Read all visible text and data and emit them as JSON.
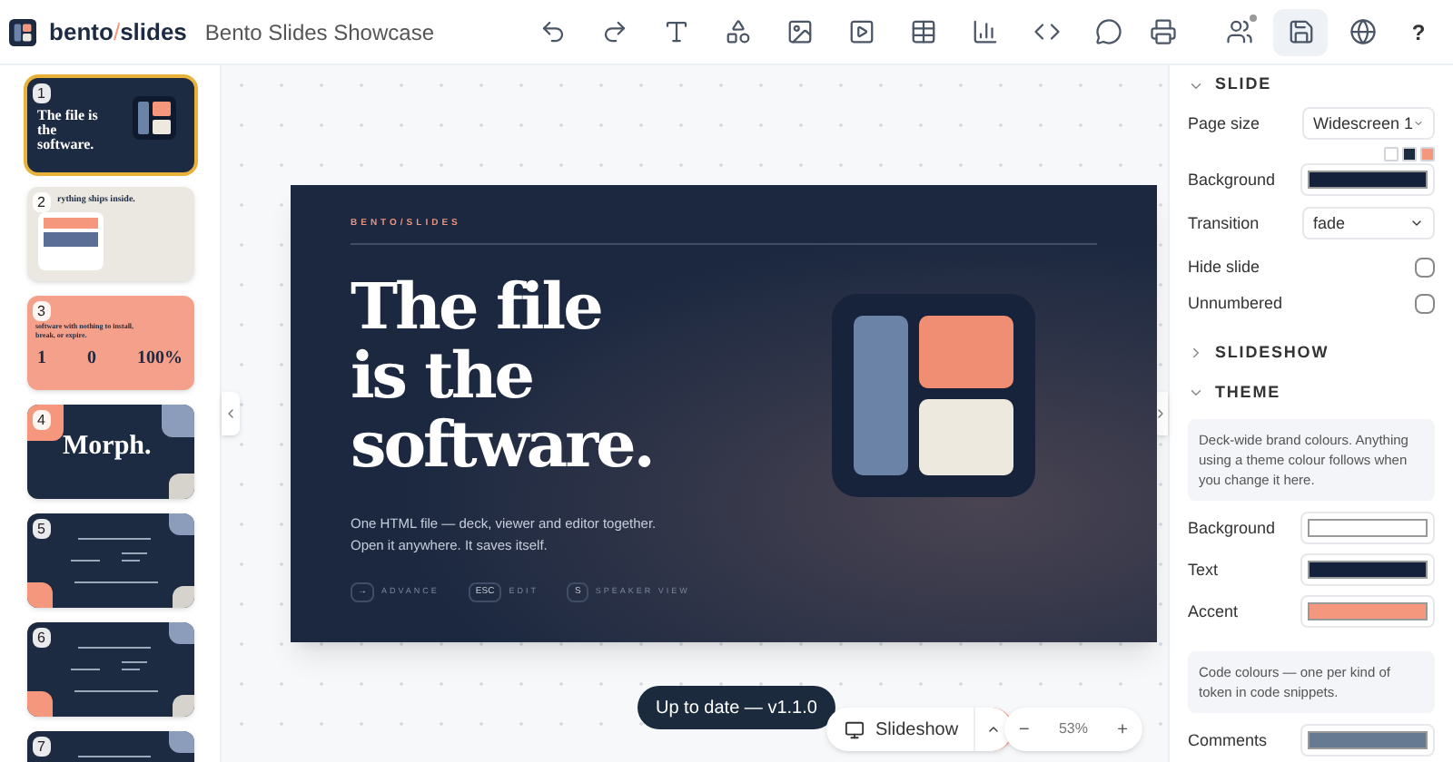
{
  "app": {
    "brand_main": "bento",
    "brand_sep": "/",
    "brand_end": "slides",
    "doc_title": "Bento Slides Showcase"
  },
  "toolbar": {
    "save": {
      "selected": true
    },
    "collaborators": {
      "online": true
    },
    "help": "?"
  },
  "thumbnails": [
    {
      "number": "1",
      "selected": true,
      "kind": "cover",
      "title": "The file is the software."
    },
    {
      "number": "2",
      "selected": false,
      "kind": "light",
      "title": "rything ships inside."
    },
    {
      "number": "3",
      "selected": false,
      "kind": "stats",
      "title": "software with nothing to install, break, or expire.",
      "stats": [
        "1",
        "0",
        "100%"
      ]
    },
    {
      "number": "4",
      "selected": false,
      "kind": "morph",
      "title": "Morph."
    },
    {
      "number": "5",
      "selected": false,
      "kind": "code"
    },
    {
      "number": "6",
      "selected": false,
      "kind": "code"
    },
    {
      "number": "7",
      "selected": false,
      "kind": "code"
    }
  ],
  "slide": {
    "eyebrow": "BENTO/SLIDES",
    "title": [
      "The file",
      "is the",
      "software."
    ],
    "subtitle": "One HTML file — deck, viewer and editor together. Open it anywhere. It saves itself.",
    "keys": [
      {
        "key": "→",
        "label": "ADVANCE"
      },
      {
        "key": "ESC",
        "label": "EDIT"
      },
      {
        "key": "S",
        "label": "SPEAKER VIEW"
      }
    ]
  },
  "status": {
    "toast": "Up to date — v1.1.0",
    "slideshow": "Slideshow",
    "zoom_out": "−",
    "zoom": "53%",
    "zoom_in": "+"
  },
  "inspector": {
    "slide_section": {
      "title": "SLIDE",
      "expanded": true,
      "page_size": {
        "label": "Page size",
        "value": "Widescreen 1"
      },
      "swatches": [
        {
          "color": "#ffffff"
        },
        {
          "color": "#1b2a3d"
        },
        {
          "color": "#f4977c"
        }
      ],
      "background": {
        "label": "Background",
        "color": "#15213a"
      },
      "transition": {
        "label": "Transition",
        "value": "fade"
      },
      "toggles": [
        {
          "label": "Hide slide",
          "checked": false
        },
        {
          "label": "Unnumbered",
          "checked": false
        }
      ]
    },
    "slideshow_section": {
      "title": "SLIDESHOW",
      "expanded": false
    },
    "theme_section": {
      "title": "THEME",
      "expanded": true,
      "note": "Deck-wide brand colours. Anything using a theme colour follows when you change it here.",
      "colors": [
        {
          "label": "Background",
          "color": "#ffffff"
        },
        {
          "label": "Text",
          "color": "#15213a"
        },
        {
          "label": "Accent",
          "color": "#f4977c"
        }
      ],
      "code_note": "Code colours — one per kind of token in code snippets.",
      "code_colors": [
        {
          "label": "Comments",
          "color": "#667a91"
        }
      ]
    }
  }
}
